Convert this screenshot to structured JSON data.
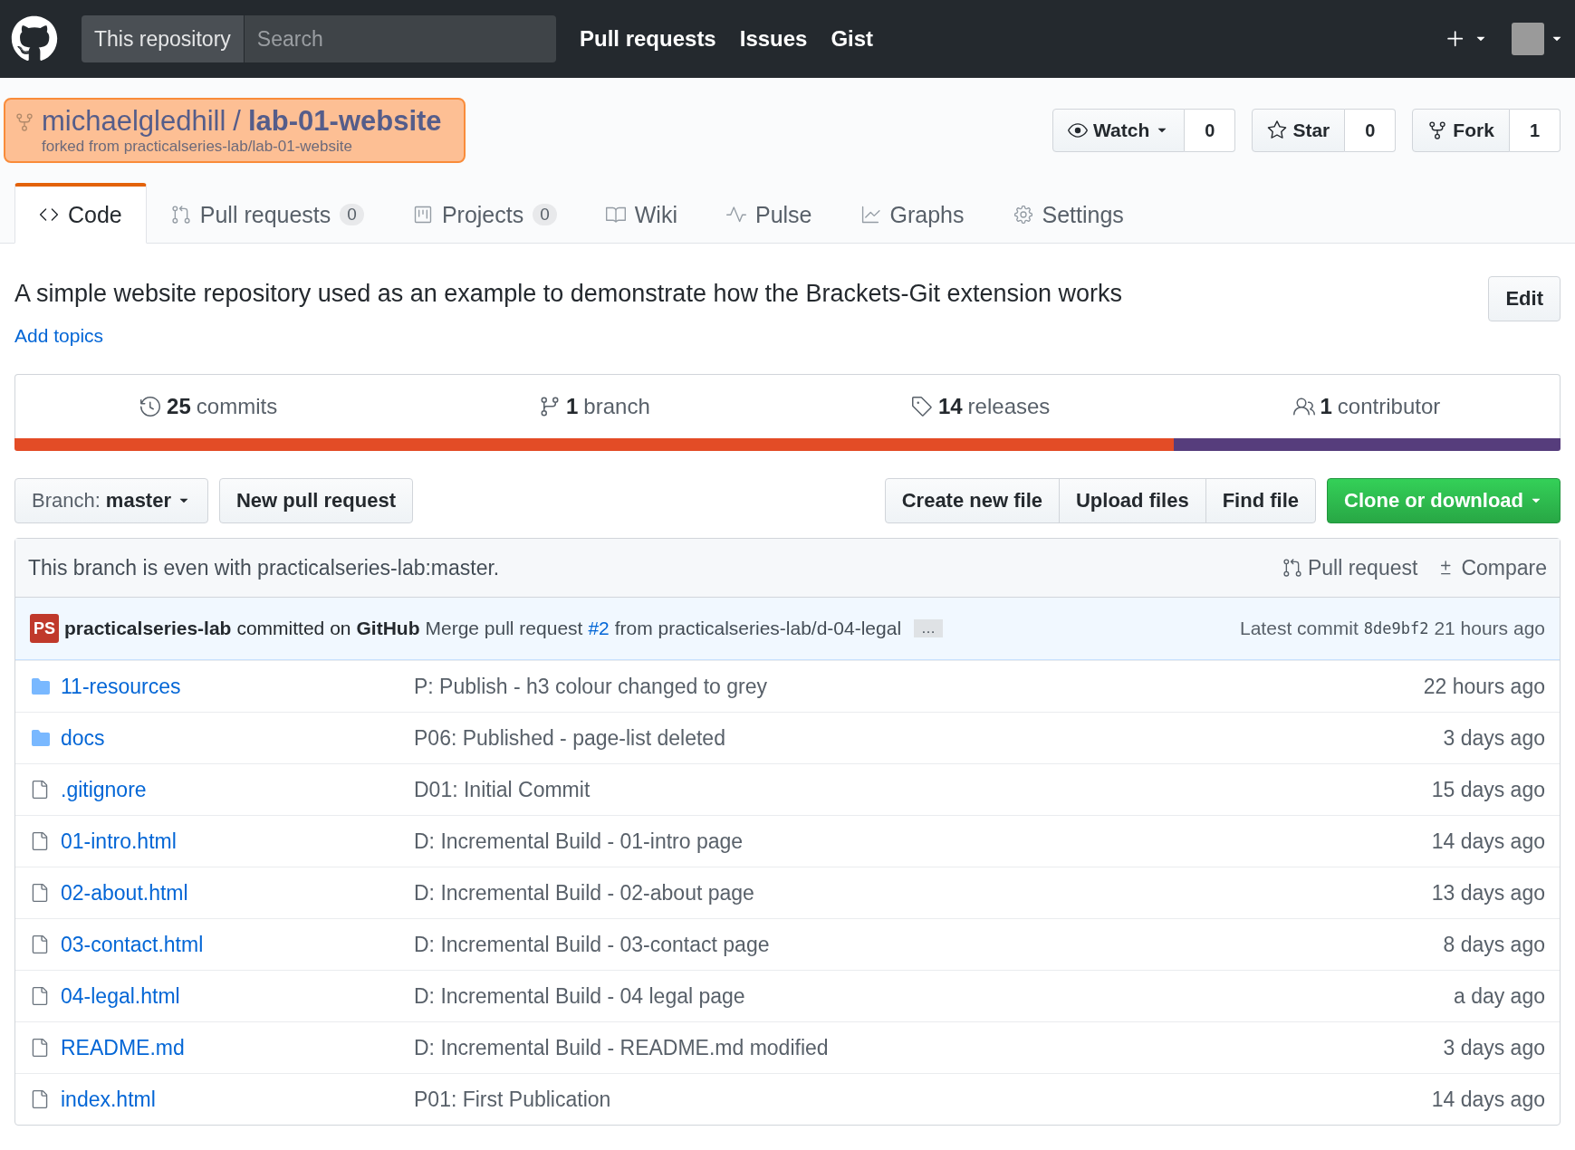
{
  "header": {
    "scope": "This repository",
    "search": {
      "placeholder": "Search"
    },
    "links": [
      "Pull requests",
      "Issues",
      "Gist"
    ]
  },
  "repo": {
    "owner": "michaelgledhill",
    "separator": "/",
    "name": "lab-01-website",
    "forked_from": "forked from practicalseries-lab/lab-01-website"
  },
  "actions": [
    {
      "label": "Watch",
      "dropdown": true,
      "count": "0"
    },
    {
      "label": "Star",
      "dropdown": false,
      "count": "0"
    },
    {
      "label": "Fork",
      "dropdown": false,
      "count": "1"
    }
  ],
  "tabs": [
    {
      "label": "Code",
      "selected": true
    },
    {
      "label": "Pull requests",
      "counter": "0",
      "selected": false
    },
    {
      "label": "Projects",
      "counter": "0",
      "selected": false
    },
    {
      "label": "Wiki",
      "selected": false
    },
    {
      "label": "Pulse",
      "selected": false
    },
    {
      "label": "Graphs",
      "selected": false
    },
    {
      "label": "Settings",
      "selected": false
    }
  ],
  "description": "A simple website repository used as an example to demonstrate how the Brackets-Git extension works",
  "edit_button": "Edit",
  "add_topics": "Add topics",
  "summary": [
    {
      "count": "25",
      "label": "commits"
    },
    {
      "count": "1",
      "label": "branch"
    },
    {
      "count": "14",
      "label": "releases"
    },
    {
      "count": "1",
      "label": "contributor"
    }
  ],
  "languages": [
    {
      "color": "#e34c26",
      "level": 0.75
    },
    {
      "color": "#563d7c",
      "level": 0.25
    }
  ],
  "branch_select": {
    "prefix": "Branch:",
    "value": "master"
  },
  "new_pull_request": "New pull request",
  "file_buttons": [
    "Create new file",
    "Upload files",
    "Find file"
  ],
  "clone_button": "Clone or download",
  "branch_status": {
    "text": "This branch is even with practicalseries-lab:master.",
    "links": [
      {
        "label": "Pull request"
      },
      {
        "label": "Compare"
      }
    ]
  },
  "commit": {
    "avatar_text": "PS",
    "author": "practicalseries-lab",
    "verb": "committed on",
    "committer": "GitHub",
    "message": "Merge pull request",
    "pr": "#2",
    "message_rest": "from practicalseries-lab/d-04-legal",
    "ellipsis": "…",
    "latest_label": "Latest commit",
    "sha": "8de9bf2",
    "age": "21 hours ago"
  },
  "files": [
    {
      "kind": "dir",
      "name": "11-resources",
      "message": "P: Publish - h3 colour changed to grey",
      "age": "22 hours ago"
    },
    {
      "kind": "dir",
      "name": "docs",
      "message": "P06: Published - page-list deleted",
      "age": "3 days ago"
    },
    {
      "kind": "file",
      "name": ".gitignore",
      "message": "D01: Initial Commit",
      "age": "15 days ago"
    },
    {
      "kind": "file",
      "name": "01-intro.html",
      "message": "D: Incremental Build - 01-intro page",
      "age": "14 days ago"
    },
    {
      "kind": "file",
      "name": "02-about.html",
      "message": "D: Incremental Build - 02-about page",
      "age": "13 days ago"
    },
    {
      "kind": "file",
      "name": "03-contact.html",
      "message": "D: Incremental Build - 03-contact page",
      "age": "8 days ago"
    },
    {
      "kind": "file",
      "name": "04-legal.html",
      "message": "D: Incremental Build - 04 legal page",
      "age": "a day ago"
    },
    {
      "kind": "file",
      "name": "README.md",
      "message": "D: Incremental Build - README.md modified",
      "age": "3 days ago"
    },
    {
      "kind": "file",
      "name": "index.html",
      "message": "P01: First Publication",
      "age": "14 days ago"
    }
  ]
}
